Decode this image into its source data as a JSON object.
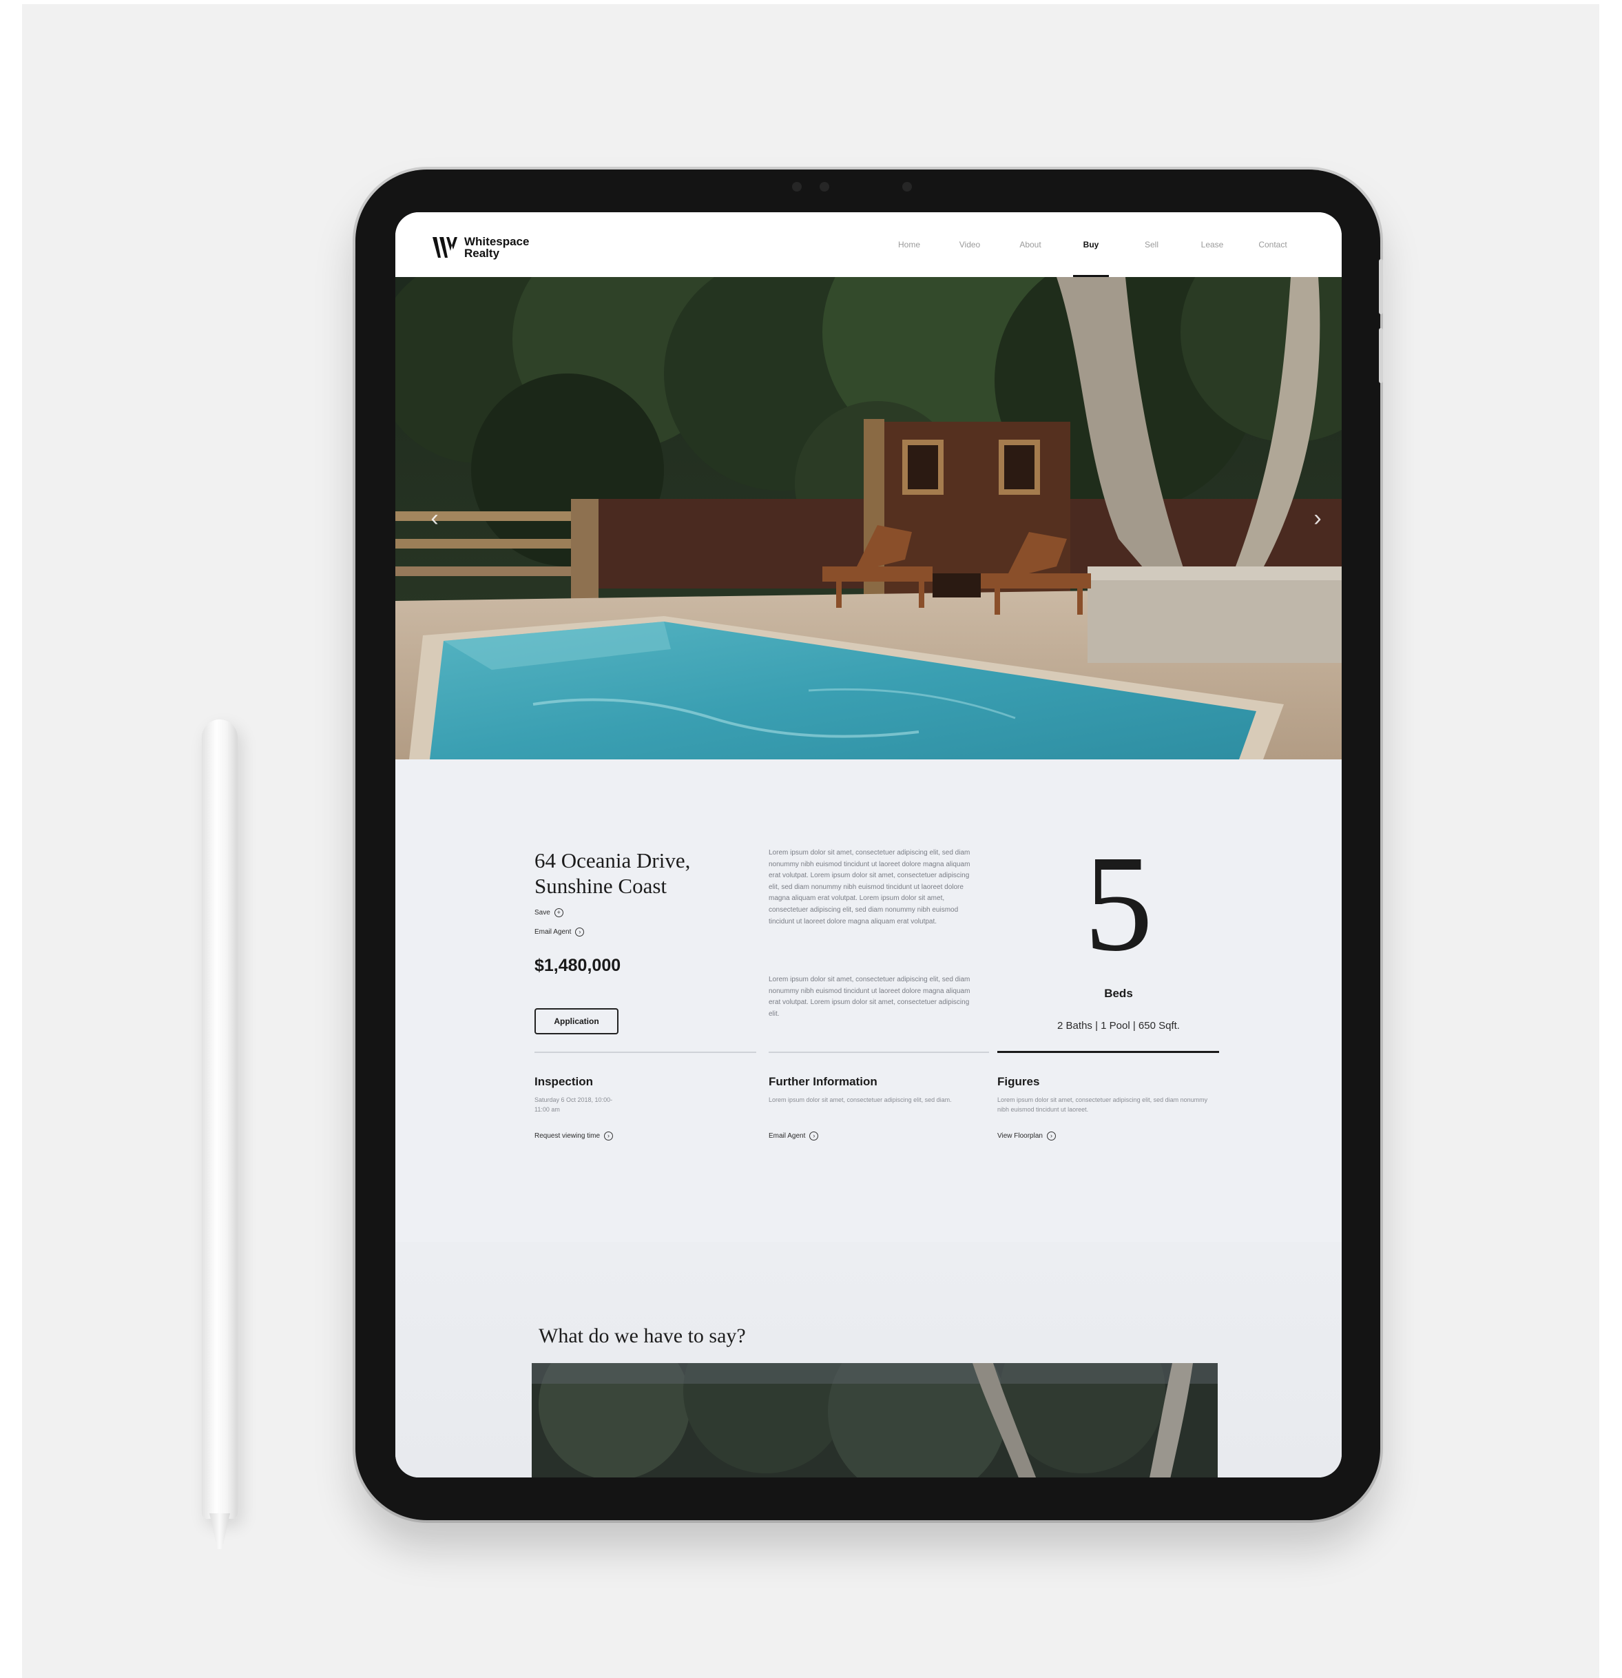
{
  "brand": {
    "name_line1": "Whitespace",
    "name_line2": "Realty"
  },
  "nav": {
    "items": [
      {
        "label": "Home",
        "active": false
      },
      {
        "label": "Video",
        "active": false
      },
      {
        "label": "About",
        "active": false
      },
      {
        "label": "Buy",
        "active": true
      },
      {
        "label": "Sell",
        "active": false
      },
      {
        "label": "Lease",
        "active": false
      },
      {
        "label": "Contact",
        "active": false
      }
    ]
  },
  "hero": {
    "prev_arrow": "‹",
    "next_arrow": "›"
  },
  "listing": {
    "address_line1": "64 Oceania Drive,",
    "address_line2": "Sunshine Coast",
    "save_label": "Save",
    "email_agent_label": "Email Agent",
    "price": "$1,480,000",
    "application_button": "Application",
    "description_p1": "Lorem ipsum dolor sit amet, consectetuer adipiscing elit, sed diam nonummy nibh euismod tincidunt ut laoreet dolore magna aliquam erat volutpat. Lorem ipsum dolor sit amet, consectetuer adipiscing elit, sed diam nonummy nibh euismod tincidunt ut laoreet dolore magna aliquam erat volutpat. Lorem ipsum dolor sit amet, consectetuer adipiscing elit, sed diam nonummy nibh euismod tincidunt ut laoreet dolore magna aliquam erat volutpat.",
    "description_p2": "Lorem ipsum dolor sit amet, consectetuer adipiscing elit, sed diam nonummy nibh euismod tincidunt ut laoreet dolore magna aliquam erat volutpat. Lorem ipsum dolor sit amet, consectetuer adipiscing elit.",
    "beds_count": "5",
    "beds_label": "Beds",
    "stats": "2 Baths  |  1 Pool  |  650 Sqft."
  },
  "info_columns": [
    {
      "title": "Inspection",
      "text": "Saturday 6 Oct 2018, 10:00-11:00 am",
      "link": "Request viewing time"
    },
    {
      "title": "Further Information",
      "text": "Lorem ipsum dolor sit amet, consectetuer adipiscing elit, sed diam.",
      "link": "Email Agent"
    },
    {
      "title": "Figures",
      "text": "Lorem ipsum dolor sit amet, consectetuer adipiscing elit, sed diam nonummy nibh euismod tincidunt ut laoreet.",
      "link": "View Floorplan"
    }
  ],
  "lower_section": {
    "heading": "What do we have to say?"
  },
  "colors": {
    "accent": "#1a1a1a",
    "page_bg": "#eef0f4",
    "pool": "#3fa7b8"
  }
}
